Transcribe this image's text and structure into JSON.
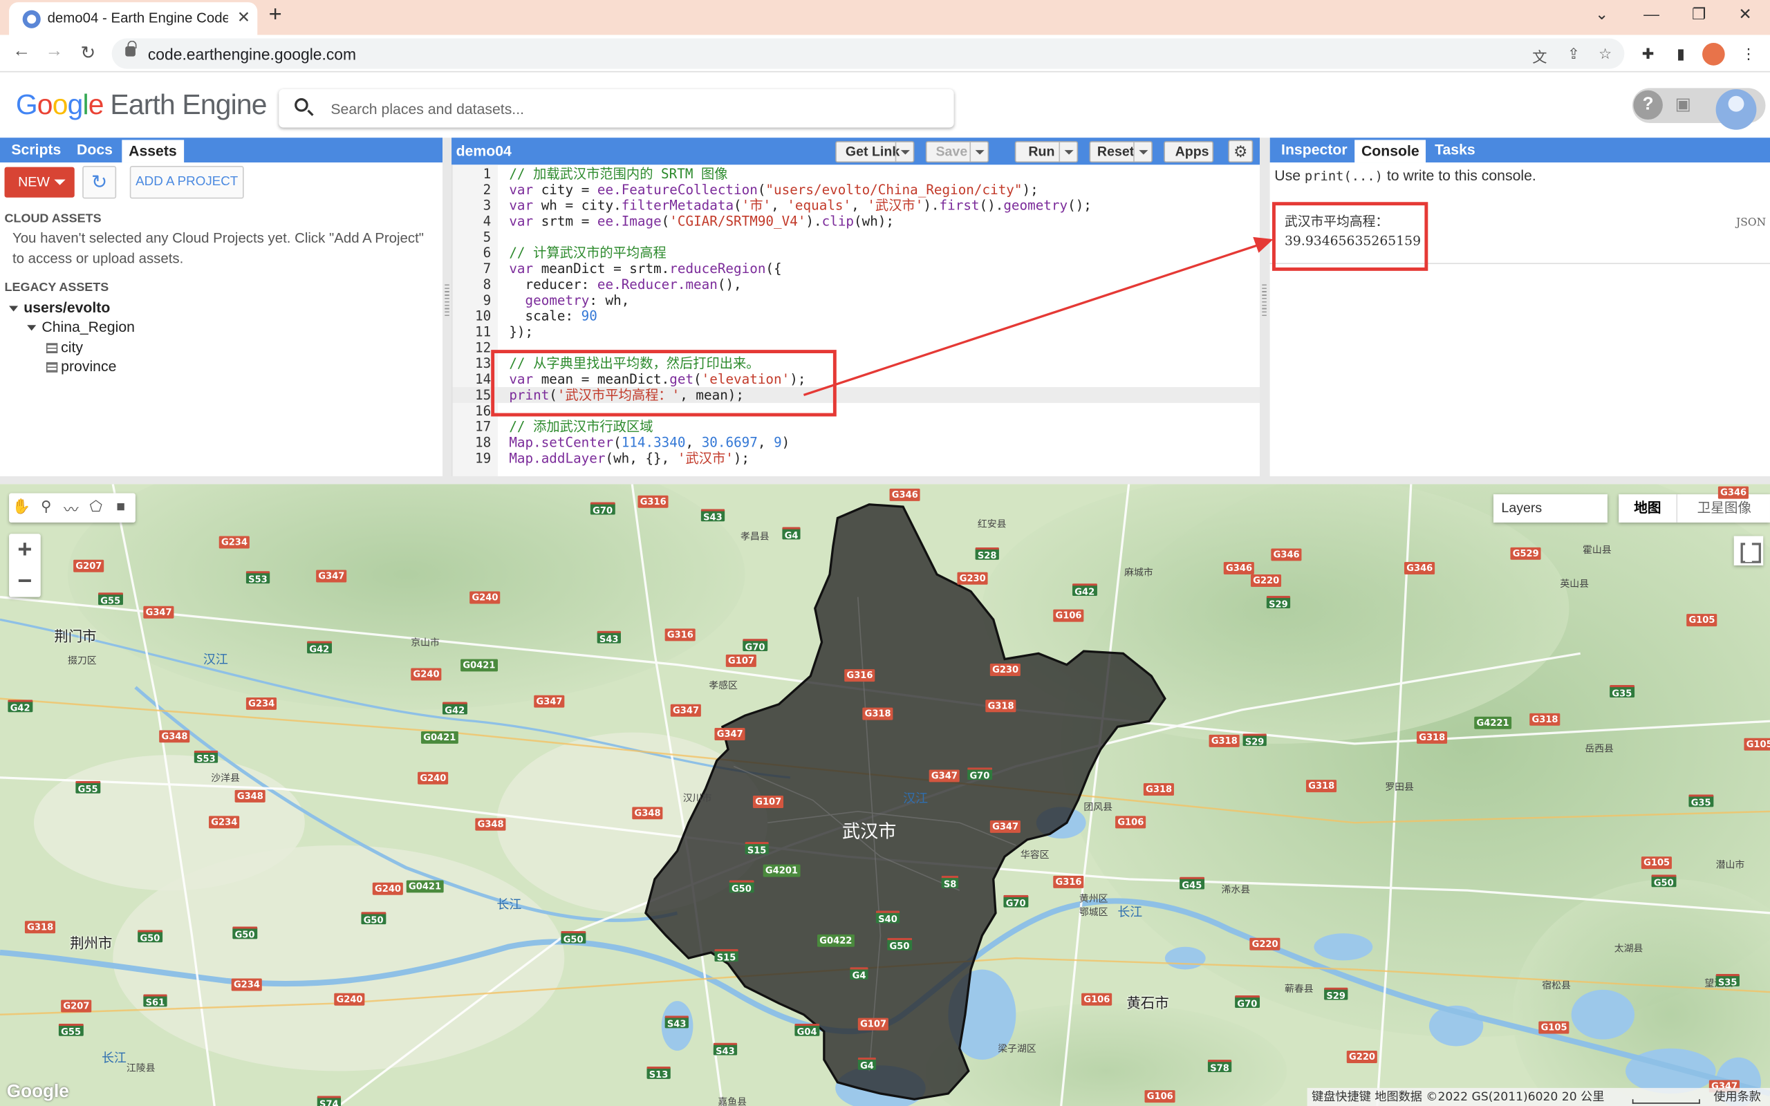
{
  "browser": {
    "tab_title": "demo04 - Earth Engine Code E",
    "url": "code.earthengine.google.com"
  },
  "header": {
    "logo_text": "Google",
    "product": "Earth Engine",
    "search_placeholder": "Search places and datasets..."
  },
  "left_panel": {
    "tabs": [
      "Scripts",
      "Docs",
      "Assets"
    ],
    "active_tab": "Assets",
    "new_label": "NEW",
    "add_project_label": "ADD A PROJECT",
    "cloud_assets_heading": "CLOUD ASSETS",
    "cloud_assets_message_1": "You haven't selected any Cloud Projects yet. Click \"Add A Project\"",
    "cloud_assets_message_2": "to access or upload assets.",
    "legacy_assets_heading": "LEGACY ASSETS",
    "tree": {
      "root": "users/evolto",
      "folder": "China_Region",
      "items": [
        "city",
        "province"
      ]
    }
  },
  "editor": {
    "script_name": "demo04",
    "buttons": {
      "get_link": "Get Link",
      "save": "Save",
      "run": "Run",
      "reset": "Reset",
      "apps": "Apps"
    },
    "current_line": 15,
    "lines": [
      "// 加载武汉市范围内的 SRTM 图像",
      "var city = ee.FeatureCollection(\"users/evolto/China_Region/city\");",
      "var wh = city.filterMetadata('市', 'equals', '武汉市').first().geometry();",
      "var srtm = ee.Image('CGIAR/SRTM90_V4').clip(wh);",
      "",
      "// 计算武汉市的平均高程",
      "var meanDict = srtm.reduceRegion({",
      "  reducer: ee.Reducer.mean(),",
      "  geometry: wh,",
      "  scale: 90",
      "});",
      "",
      "// 从字典里找出平均数，然后打印出来。",
      "var mean = meanDict.get('elevation');",
      "print('武汉市平均高程：', mean);",
      "",
      "// 添加武汉市行政区域",
      "Map.setCenter(114.3340, 30.6697, 9)",
      "Map.addLayer(wh, {}, '武汉市');"
    ]
  },
  "right_panel": {
    "tabs": [
      "Inspector",
      "Console",
      "Tasks"
    ],
    "active_tab": "Console",
    "hint_prefix": "Use",
    "hint_code": "print(...)",
    "hint_suffix": "to write to this console.",
    "output_label": "武汉市平均高程：",
    "output_value": "39.93465635265159",
    "json_label": "JSON"
  },
  "map": {
    "layers_label": "Layers",
    "map_types": [
      "地图",
      "卫星图像"
    ],
    "active_map_type": "地图",
    "main_label": "武汉市",
    "google_mark": "Google",
    "attribution": "键盘快捷键   地图数据 ©2022 GS(2011)6020   20 公里",
    "terms": "使用条款",
    "cities": [
      {
        "name": "荆门市"
      },
      {
        "name": "荆州市"
      },
      {
        "name": "黄石市"
      }
    ],
    "towns": [
      "掇刀区",
      "沙洋县",
      "京山市",
      "孝昌县",
      "孝感区",
      "汉川市",
      "红安县",
      "麻城市",
      "团风县",
      "华容区",
      "鄂城区",
      "黄州区",
      "浠水县",
      "蕲春县",
      "罗田县",
      "英山县",
      "岳西县",
      "潜山市",
      "太湖县",
      "宿松县",
      "望江县",
      "嘉鱼县",
      "江陵县",
      "梁子湖区",
      "霍山县"
    ],
    "rivers": [
      "汉江",
      "长江",
      "汉江",
      "长江",
      "长江"
    ]
  },
  "colors": {
    "panel_blue": "#4a89e0",
    "highlight_red": "#e53935",
    "new_button": "#d84434",
    "tab_strip": "#f9ddd0"
  }
}
